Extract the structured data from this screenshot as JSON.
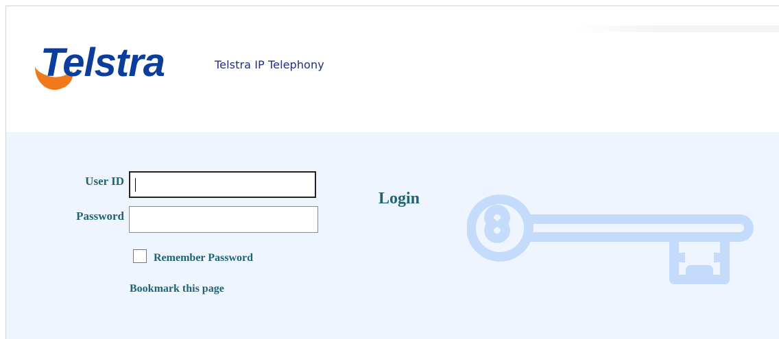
{
  "header": {
    "logo_text": "Telstra",
    "product_name": "Telstra IP Telephony"
  },
  "login": {
    "title": "Login",
    "user_id_label": "User ID",
    "user_id_value": "",
    "password_label": "Password",
    "password_value": "",
    "remember_label": "Remember Password",
    "remember_checked": false,
    "bookmark_label": "Bookmark this page"
  },
  "colors": {
    "brand_blue": "#0a3d9c",
    "brand_orange": "#f07a1a",
    "label_teal": "#1f6470",
    "panel_bg": "#eef5fe",
    "key_color": "#c5dbfb"
  },
  "icons": {
    "key": "key-icon",
    "logo": "telstra-logo"
  }
}
